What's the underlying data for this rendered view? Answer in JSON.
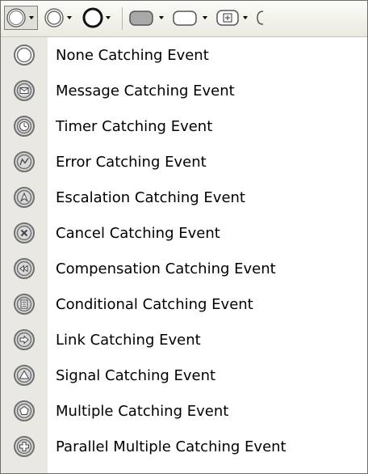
{
  "toolbar": {
    "buttons": [
      {
        "name": "none-event-thin-button",
        "icon": "thin-circle-icon"
      },
      {
        "name": "none-event-double-button",
        "icon": "double-circle-icon"
      },
      {
        "name": "none-event-thick-button",
        "icon": "thick-circle-icon"
      },
      {
        "name": "task-button",
        "icon": "rounded-rectangle-filled-icon"
      },
      {
        "name": "subprocess-button",
        "icon": "rounded-rectangle-icon"
      },
      {
        "name": "gateway-button",
        "icon": "boxed-plus-icon"
      }
    ],
    "dropdown_icon": "small-triangle-down-icon"
  },
  "menu": {
    "items": [
      {
        "label": "None Catching Event",
        "icon": "none-event-icon"
      },
      {
        "label": "Message Catching Event",
        "icon": "message-event-icon"
      },
      {
        "label": "Timer Catching Event",
        "icon": "timer-event-icon"
      },
      {
        "label": "Error Catching Event",
        "icon": "error-event-icon"
      },
      {
        "label": "Escalation Catching Event",
        "icon": "escalation-event-icon"
      },
      {
        "label": "Cancel Catching Event",
        "icon": "cancel-event-icon"
      },
      {
        "label": "Compensation Catching Event",
        "icon": "compensation-event-icon"
      },
      {
        "label": "Conditional Catching Event",
        "icon": "conditional-event-icon"
      },
      {
        "label": "Link Catching Event",
        "icon": "link-event-icon"
      },
      {
        "label": "Signal Catching Event",
        "icon": "signal-event-icon"
      },
      {
        "label": "Multiple Catching Event",
        "icon": "multiple-event-icon"
      },
      {
        "label": "Parallel Multiple Catching Event",
        "icon": "parallel-multiple-event-icon"
      }
    ]
  },
  "colors": {
    "icon_stroke": "#707070",
    "icon_fill": "#d9d9d9",
    "gutter": "#e9e8e3",
    "toolbar_bg": "#ebe9df"
  }
}
